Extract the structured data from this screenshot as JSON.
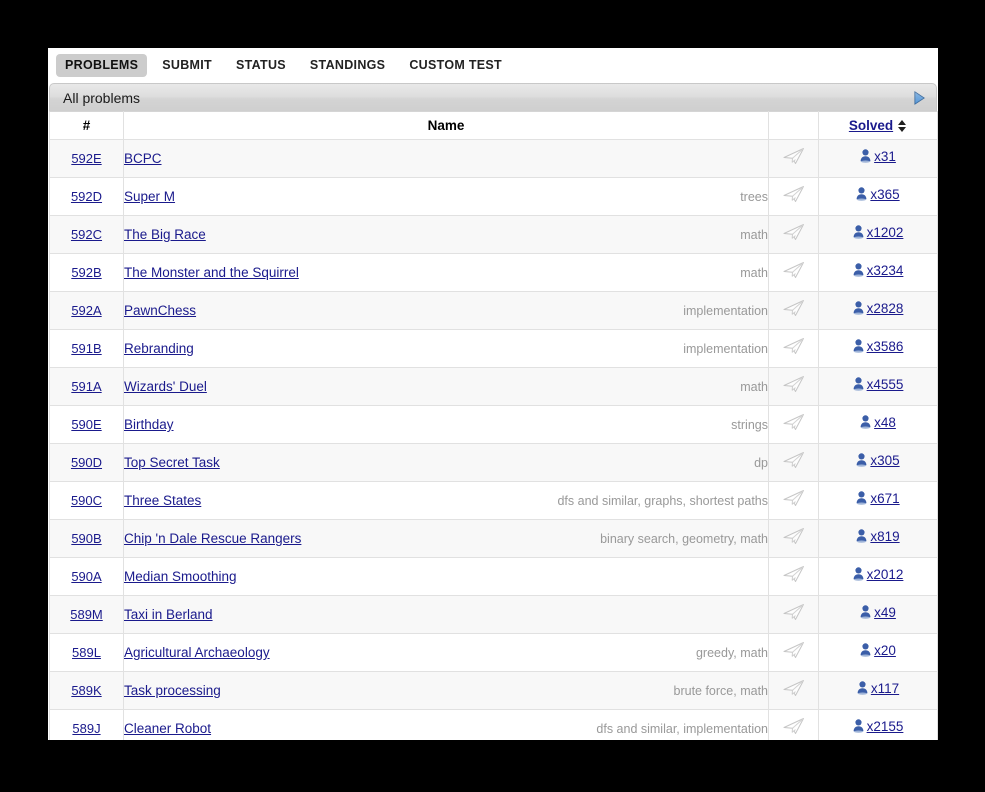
{
  "nav": {
    "tabs": [
      {
        "label": "PROBLEMS",
        "active": true
      },
      {
        "label": "SUBMIT",
        "active": false
      },
      {
        "label": "STATUS",
        "active": false
      },
      {
        "label": "STANDINGS",
        "active": false
      },
      {
        "label": "CUSTOM TEST",
        "active": false
      }
    ]
  },
  "section": {
    "title": "All problems",
    "arrow_icon": "play-triangle-icon",
    "arrow_color": "#3f7fcf"
  },
  "table": {
    "headers": {
      "id": "#",
      "name": "Name",
      "send": "",
      "solved": "Solved"
    },
    "sort_icon": "sort-updown-icon",
    "send_icon": "paper-plane-icon",
    "solver_icon": "user-icon",
    "link_color": "#1a1a8c",
    "tag_color": "#999999",
    "rows": [
      {
        "id": "592E",
        "name": "BCPC",
        "tags": "",
        "solved": "x31"
      },
      {
        "id": "592D",
        "name": "Super M",
        "tags": "trees",
        "solved": "x365"
      },
      {
        "id": "592C",
        "name": "The Big Race",
        "tags": "math",
        "solved": "x1202"
      },
      {
        "id": "592B",
        "name": "The Monster and the Squirrel",
        "tags": "math",
        "solved": "x3234"
      },
      {
        "id": "592A",
        "name": "PawnChess",
        "tags": "implementation",
        "solved": "x2828"
      },
      {
        "id": "591B",
        "name": "Rebranding",
        "tags": "implementation",
        "solved": "x3586"
      },
      {
        "id": "591A",
        "name": "Wizards' Duel",
        "tags": "math",
        "solved": "x4555"
      },
      {
        "id": "590E",
        "name": "Birthday",
        "tags": "strings",
        "solved": "x48"
      },
      {
        "id": "590D",
        "name": "Top Secret Task",
        "tags": "dp",
        "solved": "x305"
      },
      {
        "id": "590C",
        "name": "Three States",
        "tags": "dfs and similar, graphs, shortest paths",
        "solved": "x671"
      },
      {
        "id": "590B",
        "name": "Chip 'n Dale Rescue Rangers",
        "tags": "binary search, geometry, math",
        "solved": "x819"
      },
      {
        "id": "590A",
        "name": "Median Smoothing",
        "tags": "",
        "solved": "x2012"
      },
      {
        "id": "589M",
        "name": "Taxi in Berland",
        "tags": "",
        "solved": "x49"
      },
      {
        "id": "589L",
        "name": "Agricultural Archaeology",
        "tags": "greedy, math",
        "solved": "x20"
      },
      {
        "id": "589K",
        "name": "Task processing",
        "tags": "brute force, math",
        "solved": "x117"
      },
      {
        "id": "589J",
        "name": "Cleaner Robot",
        "tags": "dfs and similar, implementation",
        "solved": "x2155"
      }
    ]
  }
}
